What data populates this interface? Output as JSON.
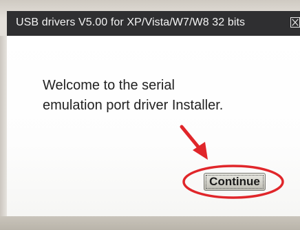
{
  "window": {
    "title": "USB drivers V5.00 for XP/Vista/W7/W8 32 bits",
    "close_icon": "close-icon"
  },
  "main": {
    "welcome_line1": "Welcome to the serial",
    "welcome_line2": "emulation port driver Installer."
  },
  "actions": {
    "continue_label": "Continue"
  },
  "annotations": {
    "arrow_icon": "red-arrow-icon",
    "highlight": "red-ellipse-highlight",
    "color": "#e0262a"
  }
}
